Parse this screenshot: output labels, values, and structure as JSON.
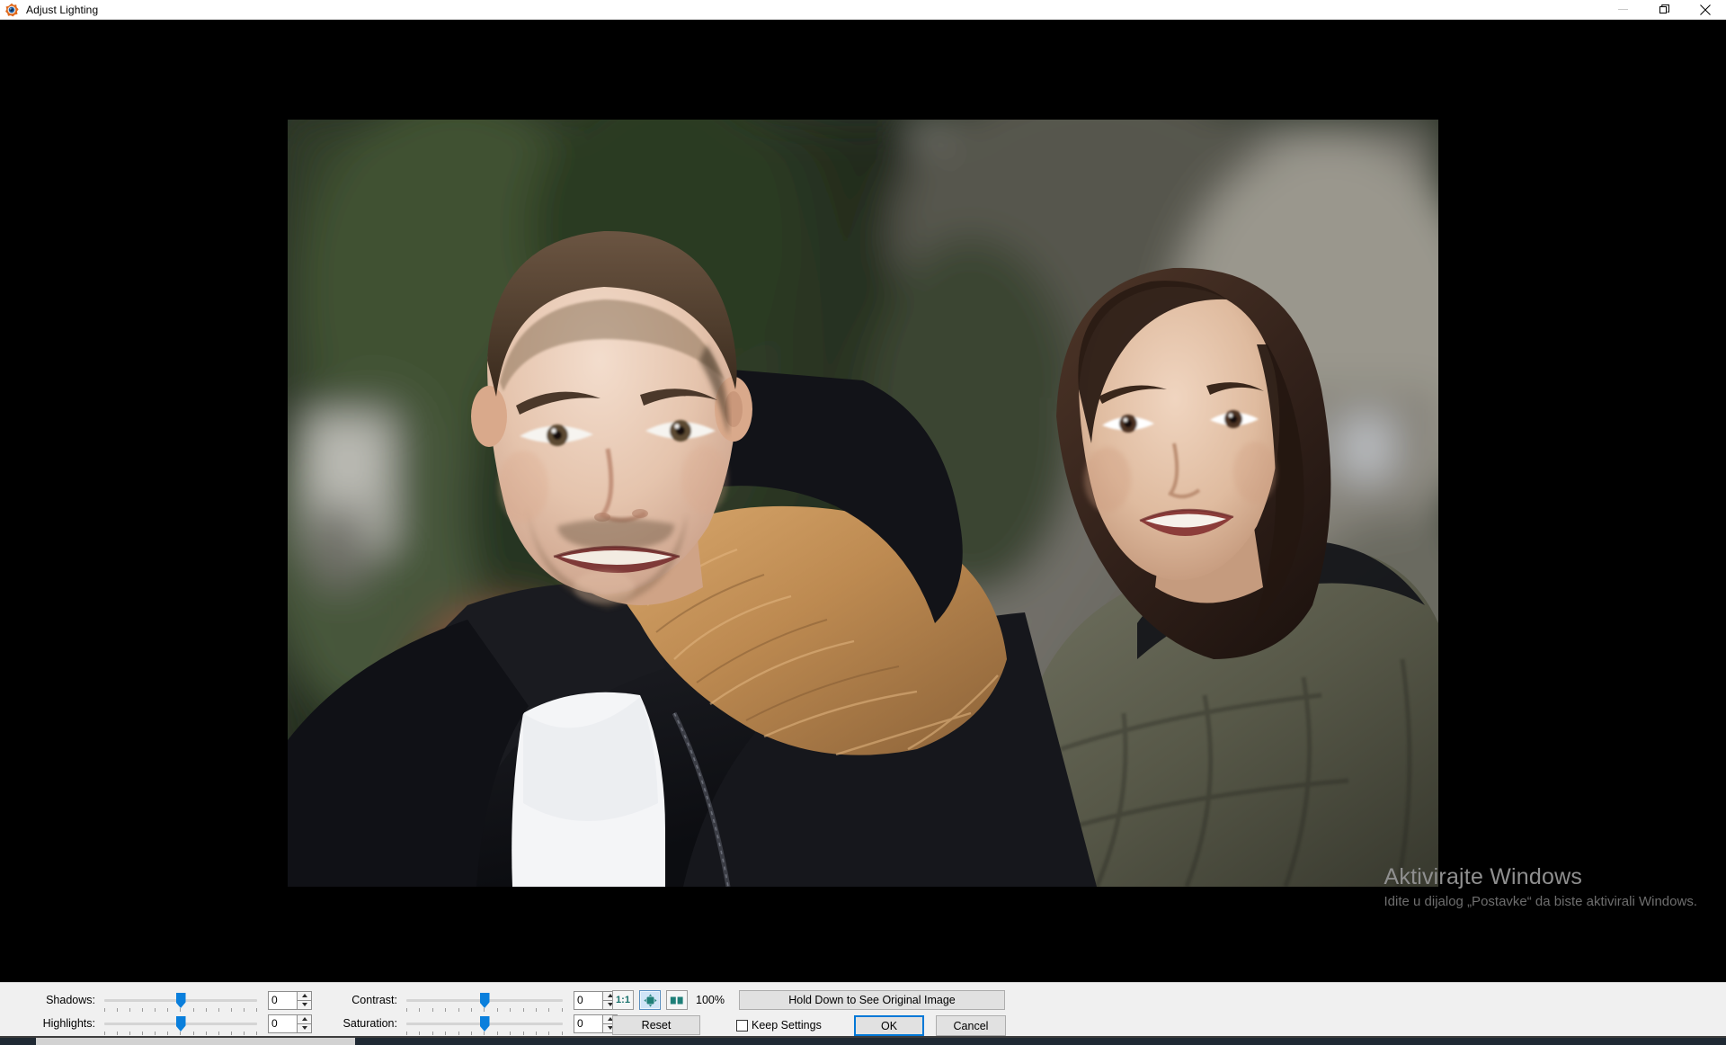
{
  "window": {
    "title": "Adjust Lighting",
    "app_icon": "faststone-app-icon",
    "controls": {
      "minimize": "minimize-icon",
      "restore": "restore-icon",
      "close": "close-icon"
    }
  },
  "watermark": {
    "title": "Aktivirajte Windows",
    "subtitle": "Idite u dijalog „Postavke“ da biste aktivirali Windows."
  },
  "preview": {
    "description": "Outdoor portrait photograph of a smiling man in a black fur-hood parka and a smiling woman in an olive-green puffer jacket, blurred green trees and buildings in the background",
    "zoom_percent": "100%"
  },
  "adjustments": [
    {
      "label": "Shadows:",
      "value": "0",
      "thumb_percent": 50
    },
    {
      "label": "Highlights:",
      "value": "0",
      "thumb_percent": 50
    },
    {
      "label": "Contrast:",
      "value": "0",
      "thumb_percent": 50
    },
    {
      "label": "Saturation:",
      "value": "0",
      "thumb_percent": 50
    }
  ],
  "zoom_controls": {
    "one_to_one_label": "1:1",
    "fit_icon": "fit-to-window-icon",
    "compare_icon": "side-by-side-compare-icon",
    "percent_label": "100%",
    "active": "fit-to-window"
  },
  "actions": {
    "hold_original": "Hold Down to See Original Image",
    "reset": "Reset",
    "keep_settings": "Keep Settings",
    "keep_settings_checked": false,
    "ok": "OK",
    "cancel": "Cancel"
  },
  "colors": {
    "accent": "#0078d7",
    "slider_thumb": "#0a7fdc",
    "toolbar_bg": "#f0f0f0",
    "canvas_bg": "#000000",
    "zoom_text": "#17706b"
  }
}
